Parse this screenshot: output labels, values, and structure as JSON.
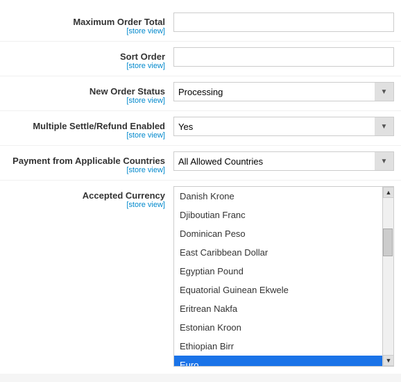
{
  "form": {
    "fields": [
      {
        "id": "max-order-total",
        "label": "Maximum Order Total",
        "sub_label": "[store view]",
        "type": "text",
        "value": ""
      },
      {
        "id": "sort-order",
        "label": "Sort Order",
        "sub_label": "[store view]",
        "type": "text",
        "value": ""
      },
      {
        "id": "new-order-status",
        "label": "New Order Status",
        "sub_label": "[store view]",
        "type": "select",
        "value": "Processing"
      },
      {
        "id": "multiple-settle",
        "label": "Multiple Settle/Refund Enabled",
        "sub_label": "[store view]",
        "type": "select",
        "value": "Yes"
      },
      {
        "id": "payment-countries",
        "label": "Payment from Applicable Countries",
        "sub_label": "[store view]",
        "type": "select",
        "value": "All Allowed Countries"
      }
    ],
    "currency_field": {
      "label": "Accepted Currency",
      "sub_label": "[store view]",
      "currencies": [
        "Danish Krone",
        "Djiboutian Franc",
        "Dominican Peso",
        "East Caribbean Dollar",
        "Egyptian Pound",
        "Equatorial Guinean Ekwele",
        "Eritrean Nakfa",
        "Estonian Kroon",
        "Ethiopian Birr",
        "Euro"
      ],
      "selected": "Euro"
    }
  }
}
